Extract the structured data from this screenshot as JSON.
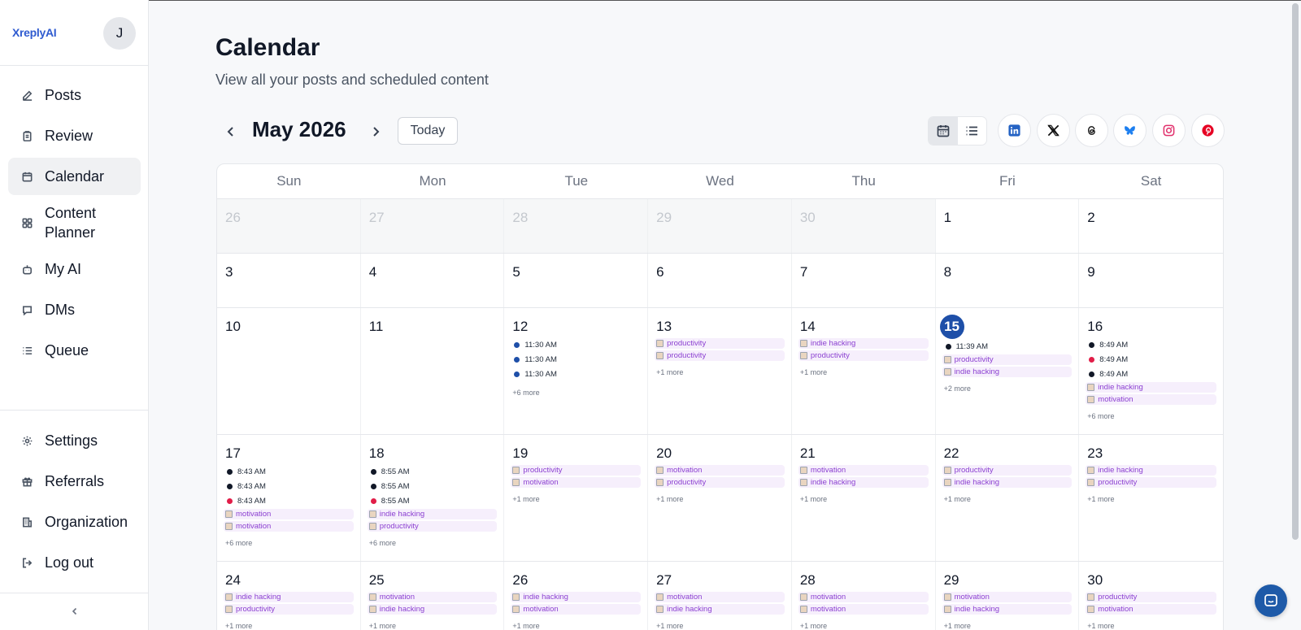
{
  "app": {
    "brand": "XreplyAI",
    "avatar_initial": "J"
  },
  "sidebar": {
    "items": [
      {
        "label": "Posts",
        "icon": "edit-icon",
        "active": false
      },
      {
        "label": "Review",
        "icon": "clipboard-icon",
        "active": false
      },
      {
        "label": "Calendar",
        "icon": "calendar-icon",
        "active": true
      },
      {
        "label": "Content Planner",
        "icon": "grid-icon",
        "active": false
      },
      {
        "label": "My AI",
        "icon": "bot-icon",
        "active": false
      },
      {
        "label": "DMs",
        "icon": "message-icon",
        "active": false
      },
      {
        "label": "Queue",
        "icon": "list-icon",
        "active": false
      }
    ],
    "bottom_items": [
      {
        "label": "Settings",
        "icon": "gear-icon"
      },
      {
        "label": "Referrals",
        "icon": "gift-icon"
      },
      {
        "label": "Organization",
        "icon": "building-icon"
      },
      {
        "label": "Log out",
        "icon": "logout-icon"
      }
    ]
  },
  "header": {
    "title": "Calendar",
    "subtitle": "View all your posts and scheduled content",
    "month_label": "May 2026",
    "today_label": "Today"
  },
  "platforms": [
    "linkedin",
    "x",
    "threads",
    "bluesky",
    "instagram",
    "pinterest"
  ],
  "colors": {
    "today": "#1e4fa8",
    "dot_blue": "#1e4fa8",
    "dot_black": "#111827",
    "dot_red": "#e11d48",
    "tag_bg": "#f6effc",
    "tag_text": "#8b3fd1"
  },
  "calendar": {
    "days_of_week": [
      "Sun",
      "Mon",
      "Tue",
      "Wed",
      "Thu",
      "Fri",
      "Sat"
    ],
    "weeks": [
      [
        {
          "day": "26",
          "other": true
        },
        {
          "day": "27",
          "other": true
        },
        {
          "day": "28",
          "other": true
        },
        {
          "day": "29",
          "other": true
        },
        {
          "day": "30",
          "other": true
        },
        {
          "day": "1"
        },
        {
          "day": "2"
        }
      ],
      [
        {
          "day": "3"
        },
        {
          "day": "4"
        },
        {
          "day": "5"
        },
        {
          "day": "6"
        },
        {
          "day": "7"
        },
        {
          "day": "8"
        },
        {
          "day": "9"
        }
      ],
      [
        {
          "day": "10"
        },
        {
          "day": "11"
        },
        {
          "day": "12",
          "events": [
            {
              "type": "time",
              "text": "11:30 AM",
              "dot": "blue"
            },
            {
              "type": "time",
              "text": "11:30 AM",
              "dot": "blue"
            },
            {
              "type": "time",
              "text": "11:30 AM",
              "dot": "blue"
            }
          ],
          "more": "+6 more"
        },
        {
          "day": "13",
          "events": [
            {
              "type": "tag",
              "text": "productivity"
            },
            {
              "type": "tag",
              "text": "productivity"
            }
          ],
          "more": "+1 more"
        },
        {
          "day": "14",
          "events": [
            {
              "type": "tag",
              "text": "indie hacking"
            },
            {
              "type": "tag",
              "text": "productivity"
            }
          ],
          "more": "+1 more"
        },
        {
          "day": "15",
          "today": true,
          "events": [
            {
              "type": "time",
              "text": "11:39 AM",
              "dot": "black"
            },
            {
              "type": "tag",
              "text": "productivity"
            },
            {
              "type": "tag",
              "text": "indie hacking"
            }
          ],
          "more": "+2 more"
        },
        {
          "day": "16",
          "events": [
            {
              "type": "time",
              "text": "8:49 AM",
              "dot": "black"
            },
            {
              "type": "time",
              "text": "8:49 AM",
              "dot": "red"
            },
            {
              "type": "time",
              "text": "8:49 AM",
              "dot": "black"
            },
            {
              "type": "tag",
              "text": "indie hacking"
            },
            {
              "type": "tag",
              "text": "motivation"
            }
          ],
          "more": "+6 more"
        }
      ],
      [
        {
          "day": "17",
          "events": [
            {
              "type": "time",
              "text": "8:43 AM",
              "dot": "black"
            },
            {
              "type": "time",
              "text": "8:43 AM",
              "dot": "black"
            },
            {
              "type": "time",
              "text": "8:43 AM",
              "dot": "red"
            },
            {
              "type": "tag",
              "text": "motivation"
            },
            {
              "type": "tag",
              "text": "motivation"
            }
          ],
          "more": "+6 more"
        },
        {
          "day": "18",
          "events": [
            {
              "type": "time",
              "text": "8:55 AM",
              "dot": "black"
            },
            {
              "type": "time",
              "text": "8:55 AM",
              "dot": "black"
            },
            {
              "type": "time",
              "text": "8:55 AM",
              "dot": "red"
            },
            {
              "type": "tag",
              "text": "indie hacking"
            },
            {
              "type": "tag",
              "text": "productivity"
            }
          ],
          "more": "+6 more"
        },
        {
          "day": "19",
          "events": [
            {
              "type": "tag",
              "text": "productivity"
            },
            {
              "type": "tag",
              "text": "motivation"
            }
          ],
          "more": "+1 more"
        },
        {
          "day": "20",
          "events": [
            {
              "type": "tag",
              "text": "motivation"
            },
            {
              "type": "tag",
              "text": "productivity"
            }
          ],
          "more": "+1 more"
        },
        {
          "day": "21",
          "events": [
            {
              "type": "tag",
              "text": "motivation"
            },
            {
              "type": "tag",
              "text": "indie hacking"
            }
          ],
          "more": "+1 more"
        },
        {
          "day": "22",
          "events": [
            {
              "type": "tag",
              "text": "productivity"
            },
            {
              "type": "tag",
              "text": "indie hacking"
            }
          ],
          "more": "+1 more"
        },
        {
          "day": "23",
          "events": [
            {
              "type": "tag",
              "text": "indie hacking"
            },
            {
              "type": "tag",
              "text": "productivity"
            }
          ],
          "more": "+1 more"
        }
      ],
      [
        {
          "day": "24",
          "events": [
            {
              "type": "tag",
              "text": "indie hacking"
            },
            {
              "type": "tag",
              "text": "productivity"
            }
          ],
          "more": "+1 more"
        },
        {
          "day": "25",
          "events": [
            {
              "type": "tag",
              "text": "motivation"
            },
            {
              "type": "tag",
              "text": "indie hacking"
            }
          ],
          "more": "+1 more"
        },
        {
          "day": "26",
          "events": [
            {
              "type": "tag",
              "text": "indie hacking"
            },
            {
              "type": "tag",
              "text": "motivation"
            }
          ],
          "more": "+1 more"
        },
        {
          "day": "27",
          "events": [
            {
              "type": "tag",
              "text": "motivation"
            },
            {
              "type": "tag",
              "text": "indie hacking"
            }
          ],
          "more": "+1 more"
        },
        {
          "day": "28",
          "events": [
            {
              "type": "tag",
              "text": "motivation"
            },
            {
              "type": "tag",
              "text": "motivation"
            }
          ],
          "more": "+1 more"
        },
        {
          "day": "29",
          "events": [
            {
              "type": "tag",
              "text": "motivation"
            },
            {
              "type": "tag",
              "text": "indie hacking"
            }
          ],
          "more": "+1 more"
        },
        {
          "day": "30",
          "events": [
            {
              "type": "tag",
              "text": "productivity"
            },
            {
              "type": "tag",
              "text": "motivation"
            }
          ],
          "more": "+1 more"
        }
      ]
    ]
  }
}
